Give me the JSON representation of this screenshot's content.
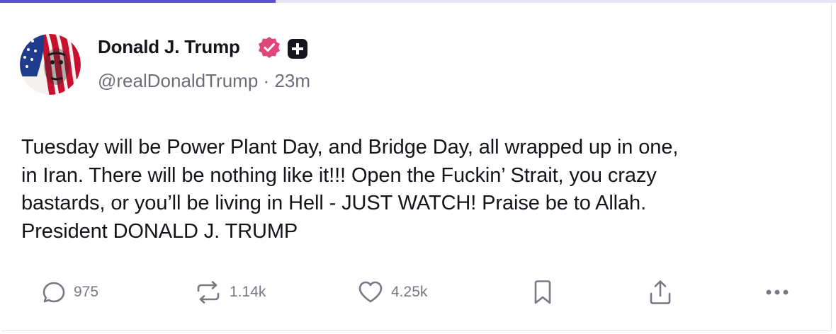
{
  "progress": {
    "fraction": 0.33,
    "color": "#5b4fd6"
  },
  "post": {
    "author": {
      "display_name": "Donald J. Trump",
      "handle": "@realDonaldTrump",
      "separator": "·",
      "time_ago": "23m",
      "verified_color": "#e0457b"
    },
    "body_lines": [
      "Tuesday will be Power Plant Day, and Bridge Day, all wrapped up in one,",
      "in Iran. There will be nothing like it!!! Open the Fuckin’ Strait, you crazy",
      "bastards, or you’ll be living in Hell - JUST WATCH! Praise be to Allah.",
      "President DONALD J. TRUMP"
    ],
    "actions": {
      "replies": {
        "icon": "reply-icon",
        "count": "975"
      },
      "reposts": {
        "icon": "repost-icon",
        "count": "1.14k"
      },
      "likes": {
        "icon": "heart-icon",
        "count": "4.25k"
      },
      "bookmark": {
        "icon": "bookmark-icon"
      },
      "share": {
        "icon": "share-icon"
      },
      "more": {
        "icon": "more-dots-icon"
      }
    }
  }
}
